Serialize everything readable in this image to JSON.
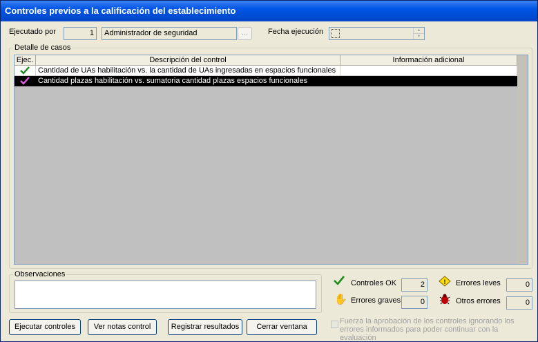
{
  "window": {
    "title": "Controles previos a la calificación del establecimiento"
  },
  "header": {
    "ejecutado_label": "Ejecutado por",
    "ejecutado_id": "1",
    "ejecutado_name": "Administrador de seguridad",
    "lookup_button": "...",
    "fecha_label": "Fecha ejecución",
    "fecha_value": ""
  },
  "detail": {
    "group_label": "Detalle de casos",
    "columns": [
      "Ejec.",
      "Descripción del control",
      "Información adicional"
    ],
    "rows": [
      {
        "ejec_icon": "check-icon",
        "descripcion": "Cantidad de UAs habilitación vs. la cantidad de UAs ingresadas en espacios funcionales",
        "info": ""
      },
      {
        "ejec_icon": "check-icon",
        "descripcion": "Cantidad plazas habilitación vs. sumatoria cantidad plazas espacios funcionales",
        "info": ""
      }
    ]
  },
  "observaciones": {
    "label": "Observaciones",
    "value": ""
  },
  "stats": {
    "ok_label": "Controles OK",
    "ok_value": "2",
    "graves_label": "Errores graves",
    "graves_value": "0",
    "leves_label": "Errores leves",
    "leves_value": "0",
    "otros_label": "Otros errores",
    "otros_value": "0"
  },
  "buttons": {
    "ejecutar": "Ejecutar controles",
    "ver_notas": "Ver notas control",
    "registrar": "Registrar resultados",
    "cerrar": "Cerrar ventana"
  },
  "force": {
    "text": "Fuerza la aprobación de los controles ignorando los errores informados para poder continuar con la evaluación"
  },
  "colors": {
    "title_bar": "#0055e5",
    "selected_row": "#000000",
    "check_green": "#1a8a1a",
    "check_pink": "#e060e0"
  }
}
